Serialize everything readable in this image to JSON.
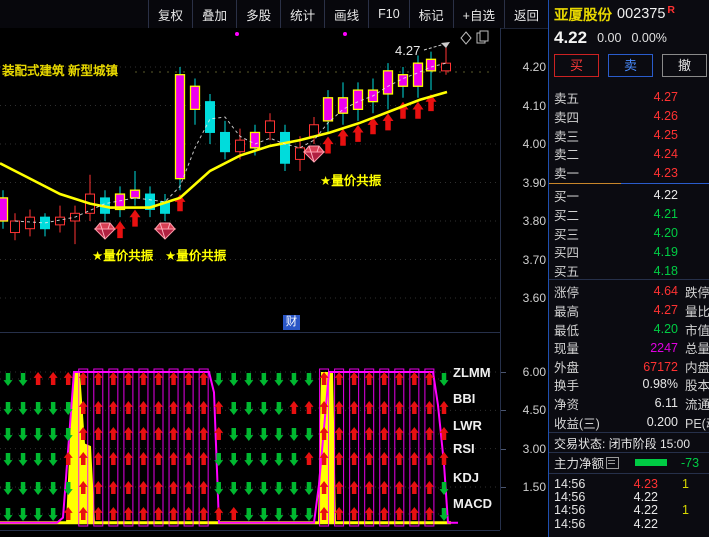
{
  "colors": {
    "red": "#ff3232",
    "green": "#00cc44",
    "white": "#e8e8e8",
    "magenta": "#e000e0",
    "candle_up": "#ff3434",
    "candle_down": "#00dcdc",
    "candle_signal_fill": "#ee00ee",
    "candle_signal_edge": "#ffff00",
    "ma_yellow": "#ffff00",
    "panel_magenta": "#ff00ff",
    "accent_blue": "#2a5ccc",
    "badge_blue": "#2a56c6",
    "text_yellow": "#e8d800"
  },
  "toolbar": {
    "buttons": [
      "复权",
      "叠加",
      "多股",
      "统计",
      "画线",
      "F10",
      "标记",
      "+自选",
      "返回"
    ]
  },
  "chart": {
    "theme_text": "装配式建筑 新型城镇",
    "high_label": "4.27",
    "signal_text_mid": "★量价共振",
    "signal_text_left1": "★量价共振",
    "signal_text_left2": "★量价共振",
    "cai_badge": "财",
    "y_axis": [
      "4.20",
      "4.10",
      "4.00",
      "3.90",
      "3.80",
      "3.70",
      "3.60"
    ]
  },
  "indicator": {
    "labels": [
      "ZLMM",
      "BBI",
      "LWR",
      "RSI",
      "KDJ",
      "MACD"
    ],
    "y_axis": [
      "6.00",
      "4.50",
      "3.00",
      "1.50"
    ]
  },
  "chart_data": [
    {
      "type": "candlestick",
      "ylabel": "price",
      "ylim": [
        3.55,
        4.3
      ],
      "y_ticks": [
        4.2,
        4.1,
        4.0,
        3.9,
        3.8,
        3.7,
        3.6
      ],
      "candles": [
        {
          "x": 3,
          "o": 3.8,
          "c": 3.86,
          "l": 3.78,
          "h": 3.88,
          "t": "signal",
          "m": null
        },
        {
          "x": 15,
          "o": 3.77,
          "c": 3.8,
          "l": 3.75,
          "h": 3.82,
          "t": "up",
          "m": null
        },
        {
          "x": 30,
          "o": 3.78,
          "c": 3.81,
          "l": 3.76,
          "h": 3.83,
          "t": "up",
          "m": null
        },
        {
          "x": 45,
          "o": 3.81,
          "c": 3.78,
          "l": 3.76,
          "h": 3.82,
          "t": "down",
          "m": null
        },
        {
          "x": 60,
          "o": 3.79,
          "c": 3.81,
          "l": 3.77,
          "h": 3.84,
          "t": "up",
          "m": null
        },
        {
          "x": 75,
          "o": 3.8,
          "c": 3.82,
          "l": 3.74,
          "h": 3.84,
          "t": "up",
          "m": null
        },
        {
          "x": 90,
          "o": 3.82,
          "c": 3.87,
          "l": 3.8,
          "h": 3.92,
          "t": "up",
          "m": null
        },
        {
          "x": 105,
          "o": 3.86,
          "c": 3.82,
          "l": 3.8,
          "h": 3.88,
          "t": "down",
          "m": "diamond"
        },
        {
          "x": 120,
          "o": 3.83,
          "c": 3.87,
          "l": 3.81,
          "h": 3.89,
          "t": "signal",
          "m": "arrow"
        },
        {
          "x": 135,
          "o": 3.86,
          "c": 3.88,
          "l": 3.84,
          "h": 3.93,
          "t": "signal",
          "m": "arrow"
        },
        {
          "x": 150,
          "o": 3.87,
          "c": 3.83,
          "l": 3.81,
          "h": 3.89,
          "t": "down",
          "m": null
        },
        {
          "x": 165,
          "o": 3.85,
          "c": 3.82,
          "l": 3.8,
          "h": 3.87,
          "t": "down",
          "m": "diamond"
        },
        {
          "x": 180,
          "o": 3.91,
          "c": 4.18,
          "l": 3.88,
          "h": 4.2,
          "t": "signal",
          "m": "arrow"
        },
        {
          "x": 195,
          "o": 4.09,
          "c": 4.15,
          "l": 4.05,
          "h": 4.17,
          "t": "signal",
          "m": null
        },
        {
          "x": 210,
          "o": 4.11,
          "c": 4.03,
          "l": 4.0,
          "h": 4.13,
          "t": "down",
          "m": null
        },
        {
          "x": 225,
          "o": 4.03,
          "c": 3.98,
          "l": 3.96,
          "h": 4.06,
          "t": "down",
          "m": null
        },
        {
          "x": 240,
          "o": 3.98,
          "c": 4.01,
          "l": 3.96,
          "h": 4.04,
          "t": "up",
          "m": null
        },
        {
          "x": 255,
          "o": 3.99,
          "c": 4.03,
          "l": 3.97,
          "h": 4.05,
          "t": "signal",
          "m": null
        },
        {
          "x": 270,
          "o": 4.03,
          "c": 4.06,
          "l": 4.01,
          "h": 4.08,
          "t": "up",
          "m": null
        },
        {
          "x": 285,
          "o": 4.03,
          "c": 3.95,
          "l": 3.93,
          "h": 4.05,
          "t": "down",
          "m": null
        },
        {
          "x": 300,
          "o": 3.96,
          "c": 3.99,
          "l": 3.93,
          "h": 4.02,
          "t": "up",
          "m": null
        },
        {
          "x": 314,
          "o": 4.02,
          "c": 4.05,
          "l": 4.0,
          "h": 4.07,
          "t": "up",
          "m": "diamond"
        },
        {
          "x": 328,
          "o": 4.06,
          "c": 4.12,
          "l": 4.03,
          "h": 4.14,
          "t": "signal",
          "m": "arrow"
        },
        {
          "x": 343,
          "o": 4.08,
          "c": 4.12,
          "l": 4.05,
          "h": 4.16,
          "t": "signal",
          "m": "arrow"
        },
        {
          "x": 358,
          "o": 4.09,
          "c": 4.14,
          "l": 4.06,
          "h": 4.16,
          "t": "signal",
          "m": "arrow"
        },
        {
          "x": 373,
          "o": 4.11,
          "c": 4.14,
          "l": 4.08,
          "h": 4.17,
          "t": "signal",
          "m": "arrow"
        },
        {
          "x": 388,
          "o": 4.13,
          "c": 4.19,
          "l": 4.09,
          "h": 4.21,
          "t": "signal",
          "m": "arrow"
        },
        {
          "x": 403,
          "o": 4.15,
          "c": 4.18,
          "l": 4.12,
          "h": 4.2,
          "t": "signal",
          "m": "arrow"
        },
        {
          "x": 418,
          "o": 4.15,
          "c": 4.21,
          "l": 4.12,
          "h": 4.23,
          "t": "signal",
          "m": "arrow"
        },
        {
          "x": 431,
          "o": 4.19,
          "c": 4.22,
          "l": 4.14,
          "h": 4.24,
          "t": "signal",
          "m": "arrow"
        },
        {
          "x": 446,
          "o": 4.19,
          "c": 4.21,
          "l": 4.18,
          "h": 4.26,
          "t": "up",
          "m": null
        }
      ],
      "ma_yellow": [
        [
          0,
          3.95
        ],
        [
          30,
          3.91
        ],
        [
          60,
          3.87
        ],
        [
          90,
          3.845
        ],
        [
          110,
          3.835
        ],
        [
          150,
          3.835
        ],
        [
          180,
          3.86
        ],
        [
          210,
          3.93
        ],
        [
          240,
          3.97
        ],
        [
          270,
          3.995
        ],
        [
          300,
          4.01
        ],
        [
          330,
          4.03
        ],
        [
          360,
          4.055
        ],
        [
          390,
          4.085
        ],
        [
          420,
          4.115
        ],
        [
          447,
          4.135
        ]
      ],
      "ma_white": [
        [
          15,
          3.8
        ],
        [
          45,
          3.795
        ],
        [
          75,
          3.81
        ],
        [
          105,
          3.845
        ],
        [
          135,
          3.86
        ],
        [
          165,
          3.85
        ],
        [
          180,
          3.89
        ],
        [
          195,
          3.99
        ],
        [
          210,
          4.065
        ],
        [
          225,
          4.07
        ],
        [
          240,
          4.02
        ],
        [
          255,
          4.0
        ],
        [
          270,
          4.015
        ],
        [
          285,
          4.0
        ],
        [
          300,
          3.99
        ],
        [
          314,
          4.01
        ],
        [
          328,
          4.055
        ],
        [
          343,
          4.09
        ],
        [
          358,
          4.11
        ],
        [
          373,
          4.125
        ],
        [
          388,
          4.15
        ],
        [
          403,
          4.17
        ],
        [
          418,
          4.185
        ],
        [
          431,
          4.2
        ],
        [
          446,
          4.21
        ]
      ]
    },
    {
      "type": "signal-panel",
      "ylim": [
        0,
        6.5
      ],
      "y_ticks": [
        6.0,
        4.5,
        3.0,
        1.5
      ],
      "row_labels": [
        "ZLMM",
        "BBI",
        "LWR",
        "RSI",
        "KDJ",
        "MACD"
      ],
      "arrow_rows": [
        "GGRRRRRRRRRRRRGGGGGGGRRRRRRRR",
        "GGGGGRRRRRRRRRRGGGGRRRRRRRRRR",
        "GGGGGRRRRRRRRRRGGGGGGRRRRRRRR",
        "GGGGRRRRRRRRRRGGGGGGRRRRRRRRR",
        "GGGGGRRRRRRRRRGGGGGGGRRRRRRRR",
        "GGGGRRRRRRRRRRRRGGGGGRRRRRRRR"
      ],
      "last_col_arrows": [
        "G",
        "R",
        "R",
        "R",
        "G",
        "G"
      ],
      "envelope": [
        [
          0,
          0.1
        ],
        [
          57,
          0.1
        ],
        [
          63,
          0.3
        ],
        [
          74,
          6.0
        ],
        [
          209,
          6.0
        ],
        [
          214,
          5.2
        ],
        [
          219,
          0.1
        ],
        [
          314,
          0.1
        ],
        [
          319,
          1.6
        ],
        [
          329,
          6.0
        ],
        [
          433,
          6.0
        ],
        [
          438,
          4.7
        ],
        [
          444,
          2.4
        ],
        [
          448,
          0.1
        ],
        [
          458,
          0.1
        ]
      ],
      "yellow_spikes": [
        [
          [
            66,
            0.1
          ],
          [
            73,
            6.0
          ],
          [
            80,
            6.0
          ],
          [
            85,
            3.2
          ],
          [
            91,
            3.1
          ],
          [
            95,
            0.1
          ]
        ],
        [
          [
            318,
            0.1
          ],
          [
            321,
            6.0
          ],
          [
            333,
            6.0
          ],
          [
            336,
            0.1
          ]
        ]
      ],
      "yellow_baseline": 0.1
    }
  ],
  "quote_panel": {
    "stock_name": "亚厦股份",
    "stock_code": "002375",
    "r_tag": "R",
    "price": "4.22",
    "change": "0.00",
    "change_pct": "0.00%",
    "buy_label": "买",
    "sell_label": "卖",
    "cancel_label": "撤",
    "asks": [
      {
        "label": "卖五",
        "value": "4.27",
        "color": "red"
      },
      {
        "label": "卖四",
        "value": "4.26",
        "color": "red"
      },
      {
        "label": "卖三",
        "value": "4.25",
        "color": "red"
      },
      {
        "label": "卖二",
        "value": "4.24",
        "color": "red"
      },
      {
        "label": "卖一",
        "value": "4.23",
        "color": "red"
      }
    ],
    "bids": [
      {
        "label": "买一",
        "value": "4.22",
        "color": "white"
      },
      {
        "label": "买二",
        "value": "4.21",
        "color": "green"
      },
      {
        "label": "买三",
        "value": "4.20",
        "color": "green"
      },
      {
        "label": "买四",
        "value": "4.19",
        "color": "green"
      },
      {
        "label": "买五",
        "value": "4.18",
        "color": "green"
      }
    ],
    "stats": [
      {
        "label": "涨停",
        "value": "4.64",
        "color": "red",
        "label2": "跌停"
      },
      {
        "label": "最高",
        "value": "4.27",
        "color": "red",
        "label2": "量比"
      },
      {
        "label": "最低",
        "value": "4.20",
        "color": "green",
        "label2": "市值"
      },
      {
        "label": "现量",
        "value": "2247",
        "color": "magenta",
        "label2": "总量"
      },
      {
        "label": "外盘",
        "value": "67172",
        "color": "red",
        "label2": "内盘"
      }
    ],
    "stats2": [
      {
        "label": "换手",
        "value": "0.98%",
        "color": "white",
        "label2": "股本"
      },
      {
        "label": "净资",
        "value": "6.11",
        "color": "white",
        "label2": "流通"
      },
      {
        "label": "收益(三)",
        "value": "0.200",
        "color": "white",
        "label2": "PE(动)"
      }
    ],
    "status_line": "交易状态: 闭市阶段 15:00",
    "main_fund_label": "主力净额",
    "main_fund_value": "-73",
    "ticks": [
      {
        "time": "14:56",
        "price": "4.23",
        "color": "red",
        "vol": "1"
      },
      {
        "time": "14:56",
        "price": "4.22",
        "color": "white",
        "vol": ""
      },
      {
        "time": "14:56",
        "price": "4.22",
        "color": "white",
        "vol": "1"
      },
      {
        "time": "14:56",
        "price": "4.22",
        "color": "white",
        "vol": ""
      }
    ]
  }
}
